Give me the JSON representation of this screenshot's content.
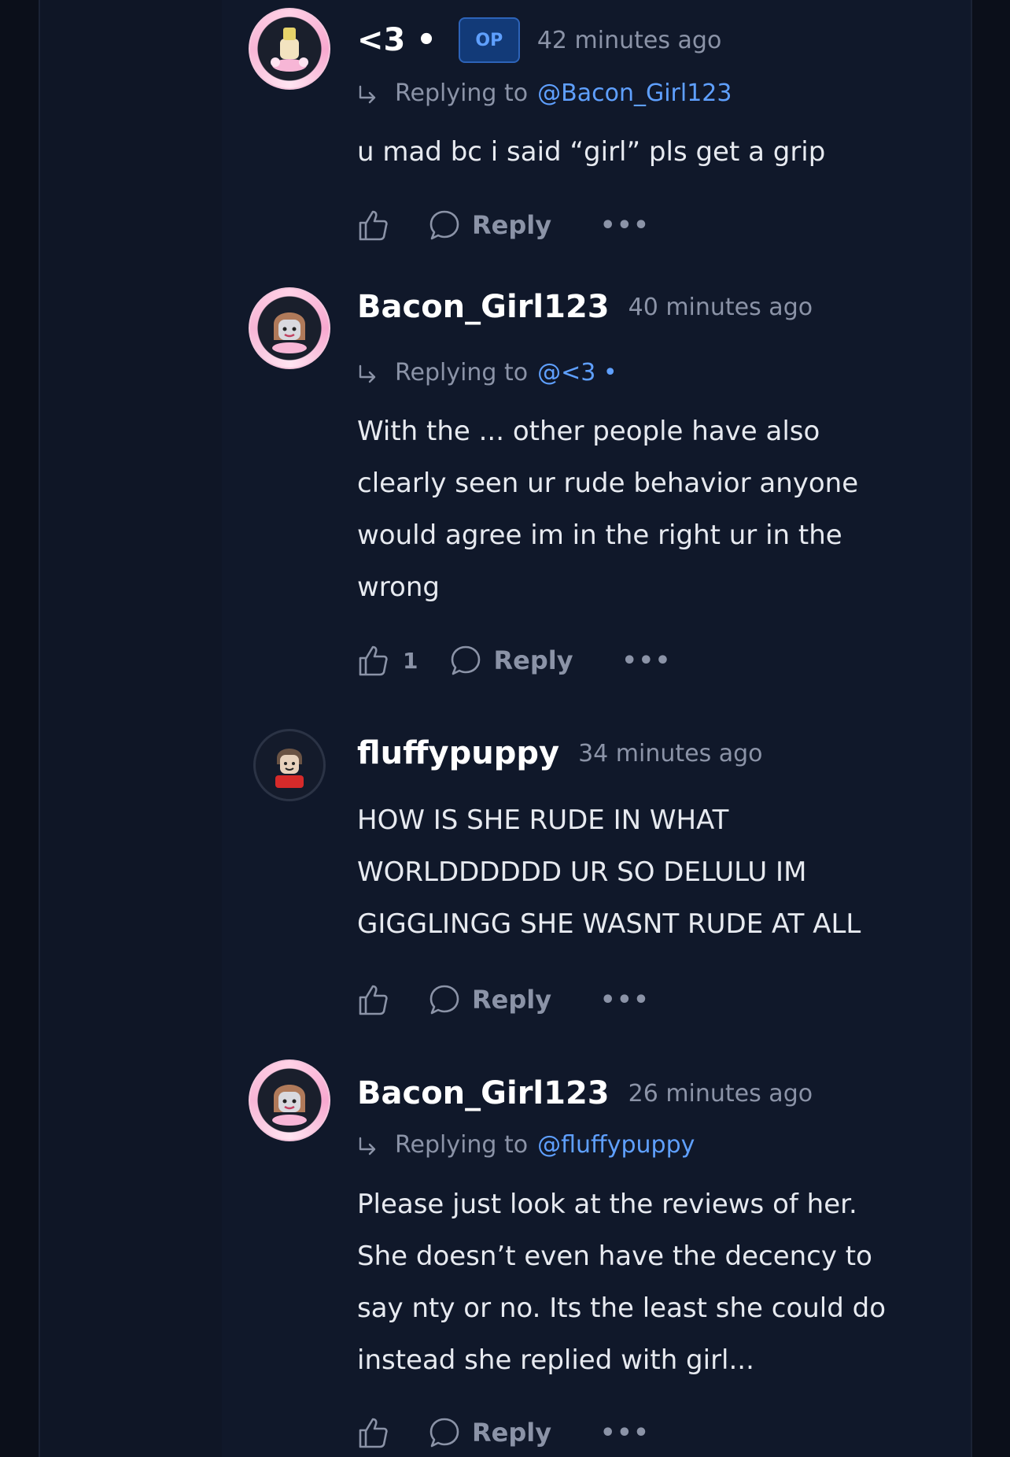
{
  "comments": [
    {
      "username": "<3 •",
      "badge": "OP",
      "timestamp": "42 minutes ago",
      "replying_label": "Replying to",
      "replying_to": "@Bacon_Girl123",
      "body": [
        "u mad bc i said “girl” pls get a grip"
      ],
      "likes": "",
      "reply_label": "Reply",
      "more_label": "•••"
    },
    {
      "username": "Bacon_Girl123",
      "timestamp": "40 minutes ago",
      "replying_label": "Replying to",
      "replying_to": "@<3 •",
      "body": [
        "With the ... other people have also",
        "clearly seen ur rude behavior anyone",
        "would agree im in the right ur in the",
        "wrong"
      ],
      "likes": "1",
      "reply_label": "Reply",
      "more_label": "•••"
    },
    {
      "username": "fluffypuppy",
      "timestamp": "34 minutes ago",
      "body": [
        "HOW IS SHE RUDE IN WHAT",
        "WORLDDDDDD UR SO DELULU IM",
        "GIGGLINGG SHE WASNT RUDE AT ALL"
      ],
      "likes": "",
      "reply_label": "Reply",
      "more_label": "•••"
    },
    {
      "username": "Bacon_Girl123",
      "timestamp": "26 minutes ago",
      "replying_label": "Replying to",
      "replying_to": "@fluffypuppy",
      "body": [
        "Please just look at the reviews of her.",
        "She doesn’t even have the decency to",
        "say nty or no. Its the least she could do",
        "instead she replied with girl..."
      ],
      "likes": "",
      "reply_label": "Reply",
      "more_label": "•••"
    }
  ],
  "colors": {
    "background": "#0b0f1a",
    "panel": "#10182a",
    "text": "#e7eaf0",
    "muted": "#8b93a7",
    "accent": "#5fa0ff",
    "op_badge_bg": "#123a78"
  },
  "icons": {
    "like": "thumbs-up-icon",
    "reply": "speech-bubble-icon",
    "more": "more-dots-icon",
    "reply_arrow": "reply-arrow-icon"
  }
}
